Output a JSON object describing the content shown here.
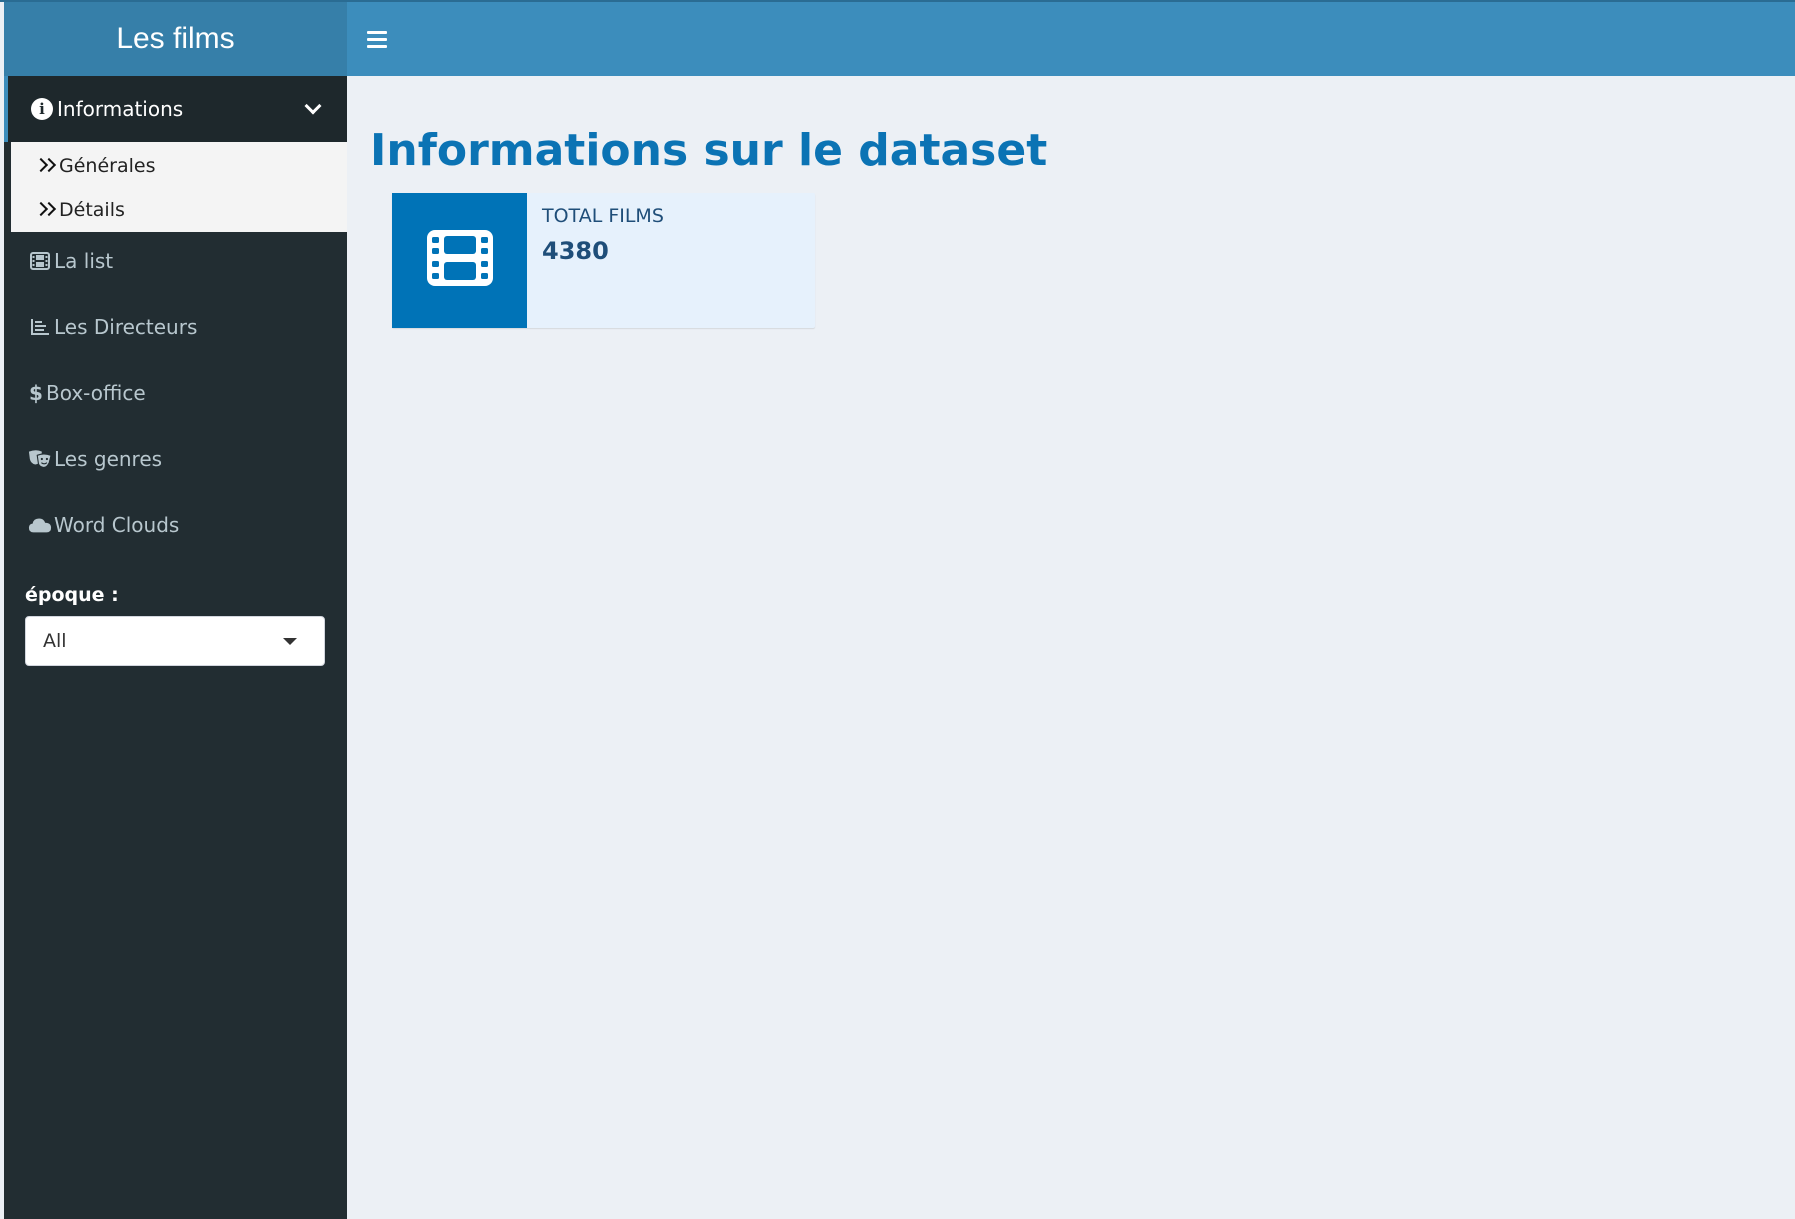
{
  "header": {
    "brand": "Les films",
    "toggle_icon": "hamburger-icon"
  },
  "sidebar": {
    "menu_head": {
      "label": "Informations",
      "icon": "info-circle-icon",
      "expanded": true
    },
    "submenu": [
      {
        "label": "Générales",
        "icon": "double-chevron-right-icon"
      },
      {
        "label": "Détails",
        "icon": "double-chevron-right-icon"
      }
    ],
    "items": [
      {
        "label": "La list",
        "icon": "film-icon"
      },
      {
        "label": "Les Directeurs",
        "icon": "bar-chart-icon"
      },
      {
        "label": "Box-office",
        "icon": "dollar-icon"
      },
      {
        "label": "Les genres",
        "icon": "theater-masks-icon"
      },
      {
        "label": "Word Clouds",
        "icon": "cloud-icon"
      }
    ],
    "filter": {
      "label": "époque :",
      "selected": "All"
    }
  },
  "main": {
    "title": "Informations sur le dataset",
    "info_box": {
      "label": "TOTAL FILMS",
      "value": "4380",
      "icon": "film-icon"
    }
  },
  "colors": {
    "header": "#3c8dbc",
    "brand": "#367fa9",
    "sidebar": "#222d32",
    "accent": "#0073b7",
    "title": "#0b73b4"
  }
}
